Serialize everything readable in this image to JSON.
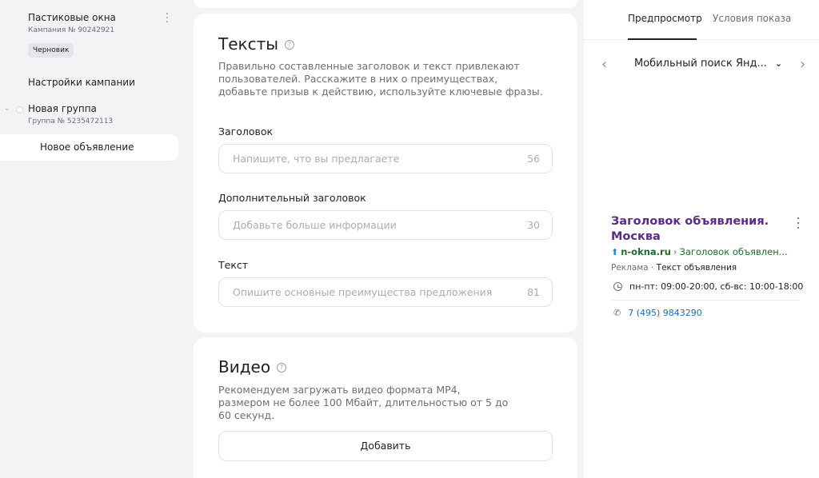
{
  "sidebar": {
    "campaign_title": "Пастиковые окна",
    "campaign_id": "Кампания № 90242921",
    "status_badge": "Черновик",
    "settings_label": "Настройки кампании",
    "group_title": "Новая группа",
    "group_id": "Группа № 5235472113",
    "ad_item_label": "Новое объявление"
  },
  "texts_card": {
    "title": "Тексты",
    "description": "Правильно составленные заголовок и текст привлекают пользователей. Расскажите в них о преимуществах, добавьте призыв к действию, используйте ключевые фразы.",
    "fields": [
      {
        "label": "Заголовок",
        "placeholder": "Напишите, что вы предлагаете",
        "counter": "56"
      },
      {
        "label": "Дополнительный заголовок",
        "placeholder": "Добавьте больше информации",
        "counter": "30"
      },
      {
        "label": "Текст",
        "placeholder": "Опишите основные преимущества предложения",
        "counter": "81"
      }
    ]
  },
  "video_card": {
    "title": "Видео",
    "description": "Рекомендуем загружать видео формата MP4, размером не более 100 Мбайт, длительностью от 5 до 60 секунд.",
    "add_label": "Добавить"
  },
  "preview": {
    "tabs": [
      {
        "label": "Предпросмотр",
        "active": true
      },
      {
        "label": "Условия показа",
        "active": false
      }
    ],
    "device": "Мобильный поиск Янд...",
    "ad": {
      "headline": "Заголовок объявления. Москва",
      "domain": "n-okna.ru",
      "separator": "›",
      "path": "Заголовок объявлен...",
      "ad_label": "Реклама",
      "dot": "·",
      "text": "Текст объявления",
      "hours": "пн-пт: 09:00-20:00, сб-вс: 10:00-18:00",
      "phone": "7 (495) 9843290"
    }
  },
  "icons": {
    "help": "?",
    "chevron_left": "‹",
    "chevron_right": "›",
    "chevron_down": "⌄",
    "caret_small": "⌄",
    "url_arrow": "⬆",
    "phone": "📞"
  },
  "colors": {
    "background": "#f2f3f5",
    "card": "#ffffff",
    "headline": "#5c2a87",
    "url": "#1f6b2e",
    "phone_link": "#1f6db7"
  }
}
